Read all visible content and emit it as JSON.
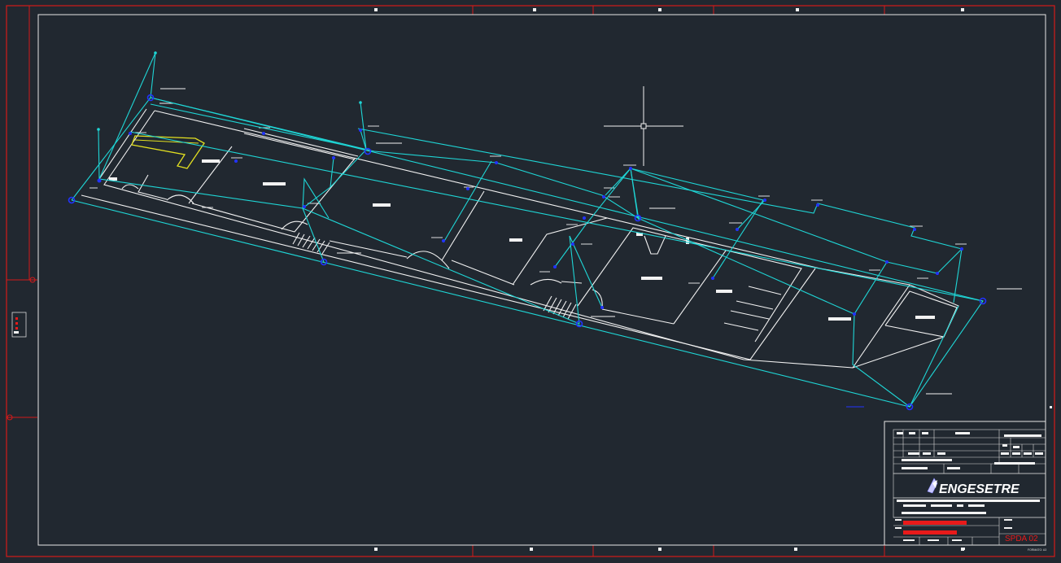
{
  "titleblock": {
    "company_name": "ENGESETRE",
    "drawing_code": "SPDA 02",
    "format_note": "FORMATO: A3"
  },
  "colors": {
    "background": "#212830",
    "sheet_border": "#d41a1a",
    "inner_frame": "#e6e6e6",
    "walls": "#f2f2f2",
    "spda_cable": "#1fd6d6",
    "electrode": "#2233ff",
    "highlight": "#e3e021",
    "stamp": "#e81a1a"
  },
  "icons": {
    "logo": "engesetre-logo-icon",
    "cursor": "crosshair-cursor-icon"
  }
}
